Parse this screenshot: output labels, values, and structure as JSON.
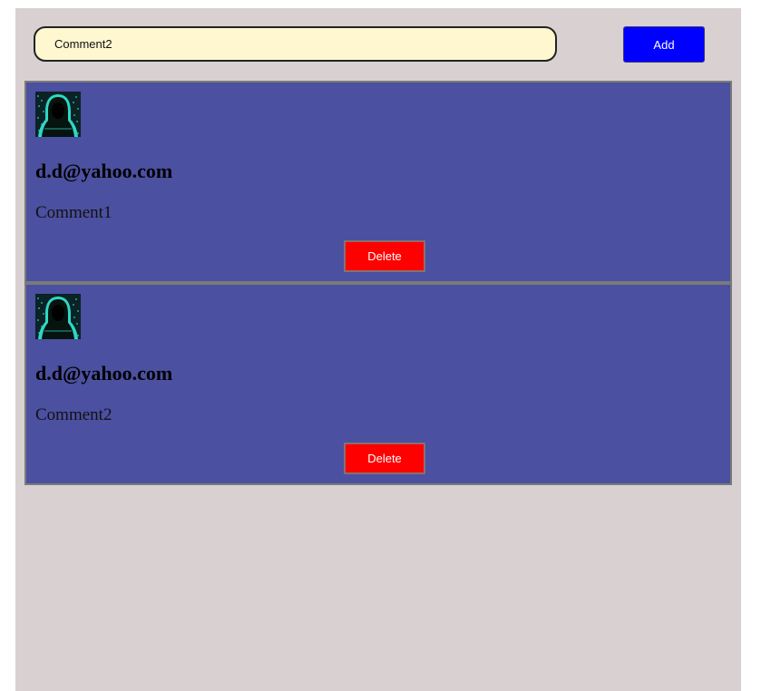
{
  "form": {
    "input_value": "Comment2",
    "add_label": "Add"
  },
  "comments": [
    {
      "avatar_icon": "hooded-hacker-avatar",
      "email": "d.d@yahoo.com",
      "text": "Comment1",
      "delete_label": "Delete"
    },
    {
      "avatar_icon": "hooded-hacker-avatar",
      "email": "d.d@yahoo.com",
      "text": "Comment2",
      "delete_label": "Delete"
    }
  ],
  "colors": {
    "page_background": "#d9d0d1",
    "input_background": "#fef7d0",
    "add_button": "#0000ff",
    "card_background": "#4b50a0",
    "delete_button": "#ff0000"
  }
}
